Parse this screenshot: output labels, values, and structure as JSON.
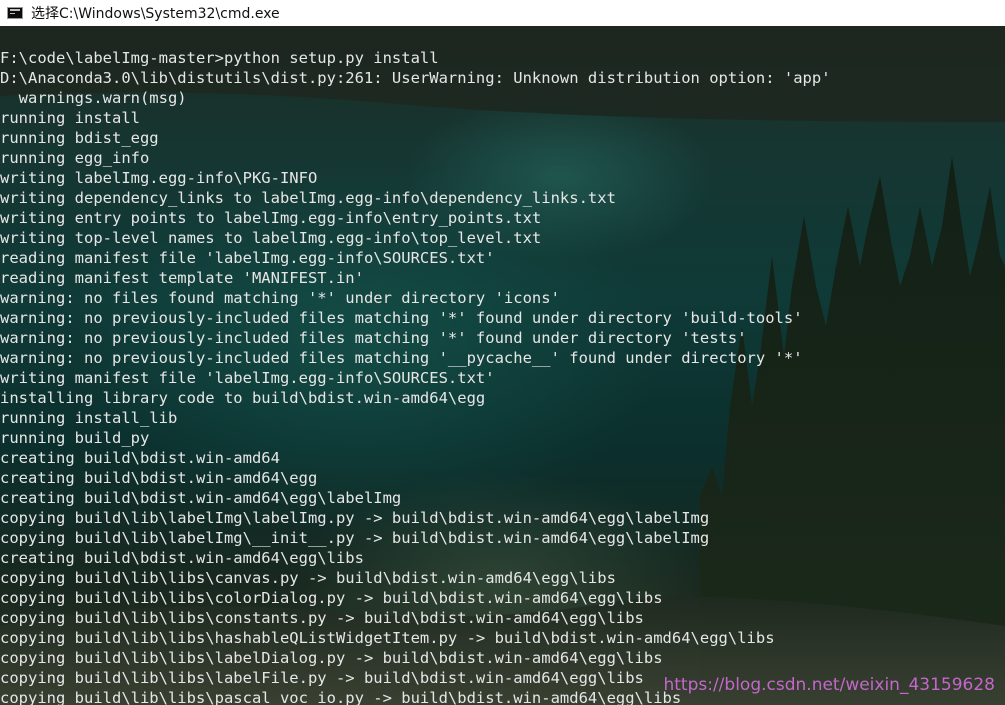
{
  "window": {
    "title": "选择C:\\Windows\\System32\\cmd.exe",
    "icon": "cmd-console-icon"
  },
  "console": {
    "lines": [
      "F:\\code\\labelImg-master>python setup.py install",
      "D:\\Anaconda3.0\\lib\\distutils\\dist.py:261: UserWarning: Unknown distribution option: 'app'",
      "  warnings.warn(msg)",
      "running install",
      "running bdist_egg",
      "running egg_info",
      "writing labelImg.egg-info\\PKG-INFO",
      "writing dependency_links to labelImg.egg-info\\dependency_links.txt",
      "writing entry points to labelImg.egg-info\\entry_points.txt",
      "writing top-level names to labelImg.egg-info\\top_level.txt",
      "reading manifest file 'labelImg.egg-info\\SOURCES.txt'",
      "reading manifest template 'MANIFEST.in'",
      "warning: no files found matching '*' under directory 'icons'",
      "warning: no previously-included files matching '*' found under directory 'build-tools'",
      "warning: no previously-included files matching '*' found under directory 'tests'",
      "warning: no previously-included files matching '__pycache__' found under directory '*'",
      "writing manifest file 'labelImg.egg-info\\SOURCES.txt'",
      "installing library code to build\\bdist.win-amd64\\egg",
      "running install_lib",
      "running build_py",
      "creating build\\bdist.win-amd64",
      "creating build\\bdist.win-amd64\\egg",
      "creating build\\bdist.win-amd64\\egg\\labelImg",
      "copying build\\lib\\labelImg\\labelImg.py -> build\\bdist.win-amd64\\egg\\labelImg",
      "copying build\\lib\\labelImg\\__init__.py -> build\\bdist.win-amd64\\egg\\labelImg",
      "creating build\\bdist.win-amd64\\egg\\libs",
      "copying build\\lib\\libs\\canvas.py -> build\\bdist.win-amd64\\egg\\libs",
      "copying build\\lib\\libs\\colorDialog.py -> build\\bdist.win-amd64\\egg\\libs",
      "copying build\\lib\\libs\\constants.py -> build\\bdist.win-amd64\\egg\\libs",
      "copying build\\lib\\libs\\hashableQListWidgetItem.py -> build\\bdist.win-amd64\\egg\\libs",
      "copying build\\lib\\libs\\labelDialog.py -> build\\bdist.win-amd64\\egg\\libs",
      "copying build\\lib\\libs\\labelFile.py -> build\\bdist.win-amd64\\egg\\libs",
      "copying build\\lib\\libs\\pascal_voc_io.py -> build\\bdist.win-amd64\\egg\\libs"
    ],
    "text_color": "#e6e6e6"
  },
  "watermark": {
    "text": "https://blog.csdn.net/weixin_43159628",
    "color": "#de6ee6"
  }
}
